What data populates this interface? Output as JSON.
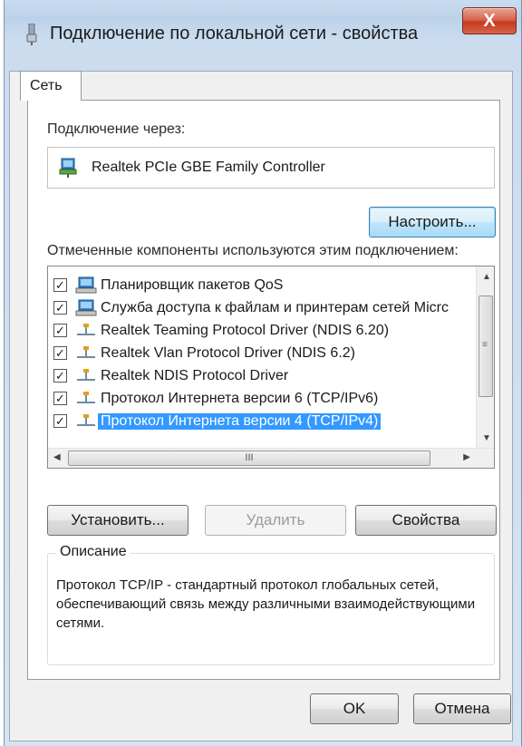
{
  "window": {
    "title": "Подключение по локальной сети - свойства",
    "close_label": "X"
  },
  "tabs": [
    {
      "label": "Сеть",
      "active": true
    }
  ],
  "connect_through": {
    "label": "Подключение через:",
    "adapter_name": "Realtek PCIe GBE Family Controller"
  },
  "configure_button": "Настроить...",
  "components": {
    "label": "Отмеченные компоненты используются этим подключением:",
    "items": [
      {
        "label": "Планировщик пакетов QoS",
        "checked": true,
        "icon": "network-service-icon",
        "selected": false
      },
      {
        "label": "Служба доступа к файлам и принтерам сетей Micrc",
        "checked": true,
        "icon": "network-service-icon",
        "selected": false
      },
      {
        "label": "Realtek Teaming Protocol Driver (NDIS 6.20)",
        "checked": true,
        "icon": "protocol-icon",
        "selected": false
      },
      {
        "label": "Realtek Vlan Protocol Driver (NDIS 6.2)",
        "checked": true,
        "icon": "protocol-icon",
        "selected": false
      },
      {
        "label": "Realtek NDIS Protocol Driver",
        "checked": true,
        "icon": "protocol-icon",
        "selected": false
      },
      {
        "label": "Протокол Интернета версии 6 (TCP/IPv6)",
        "checked": true,
        "icon": "protocol-icon",
        "selected": false
      },
      {
        "label": "Протокол Интернета версии 4 (TCP/IPv4)",
        "checked": true,
        "icon": "protocol-icon",
        "selected": true
      }
    ],
    "hscroll_grip": "III"
  },
  "buttons": {
    "install": "Установить...",
    "remove": "Удалить",
    "properties": "Свойства",
    "ok": "OK",
    "cancel": "Отмена"
  },
  "description": {
    "legend": "Описание",
    "text": "Протокол TCP/IP - стандартный протокол глобальных сетей, обеспечивающий связь между различными взаимодействующими сетями."
  },
  "colors": {
    "selection": "#3399ff",
    "close_button": "#c43b20"
  }
}
